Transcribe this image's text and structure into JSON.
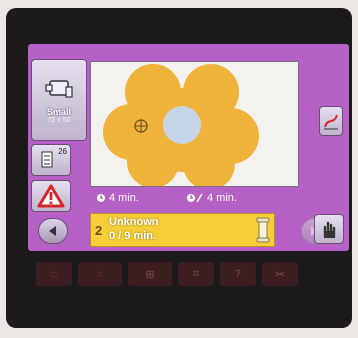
{
  "size_button": {
    "label": "Small",
    "dims": "72 x 50"
  },
  "thread_button": {
    "count": "26"
  },
  "times": {
    "remaining": "4 min.",
    "total": "4 min."
  },
  "status": {
    "step": "2",
    "name": "Unknown",
    "progress": "0 / 9 min."
  },
  "design": {
    "fill_color": "#efb23a",
    "center_color": "#c7d5e8"
  },
  "icons": {
    "size": "presser-foot-icon",
    "thread": "thread-spool-icon",
    "warning": "warning-triangle-icon",
    "prev": "arrow-left-icon",
    "next": "arrow-right-icon",
    "edit": "edit-stitch-icon",
    "hand": "hand-icon",
    "spool": "bobbin-icon"
  },
  "bezel": {
    "keys": [
      "⌂",
      "☼",
      "⊞",
      "⌗",
      "?",
      "✂"
    ]
  }
}
